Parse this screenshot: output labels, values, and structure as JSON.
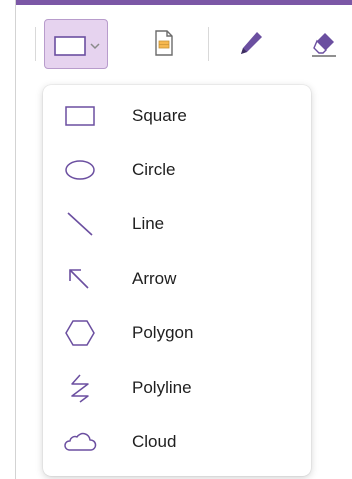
{
  "colors": {
    "accent": "#7b57a6",
    "selected_bg": "#e6d3ef",
    "icon_purple": "#6b4fa0",
    "text": "#1f1f1f"
  },
  "toolbar": {
    "shape_button_icon": "rectangle-icon",
    "dropdown_icon": "chevron-down-icon",
    "tools": [
      {
        "name": "stamp-tool",
        "icon": "image-stamp-icon"
      },
      {
        "name": "pen-tool",
        "icon": "pencil-icon"
      },
      {
        "name": "eraser-tool",
        "icon": "eraser-icon"
      }
    ]
  },
  "shape_menu": {
    "items": [
      {
        "label": "Square",
        "icon": "square-icon"
      },
      {
        "label": "Circle",
        "icon": "circle-icon"
      },
      {
        "label": "Line",
        "icon": "line-icon"
      },
      {
        "label": "Arrow",
        "icon": "arrow-icon"
      },
      {
        "label": "Polygon",
        "icon": "polygon-icon"
      },
      {
        "label": "Polyline",
        "icon": "polyline-icon"
      },
      {
        "label": "Cloud",
        "icon": "cloud-icon"
      }
    ]
  }
}
